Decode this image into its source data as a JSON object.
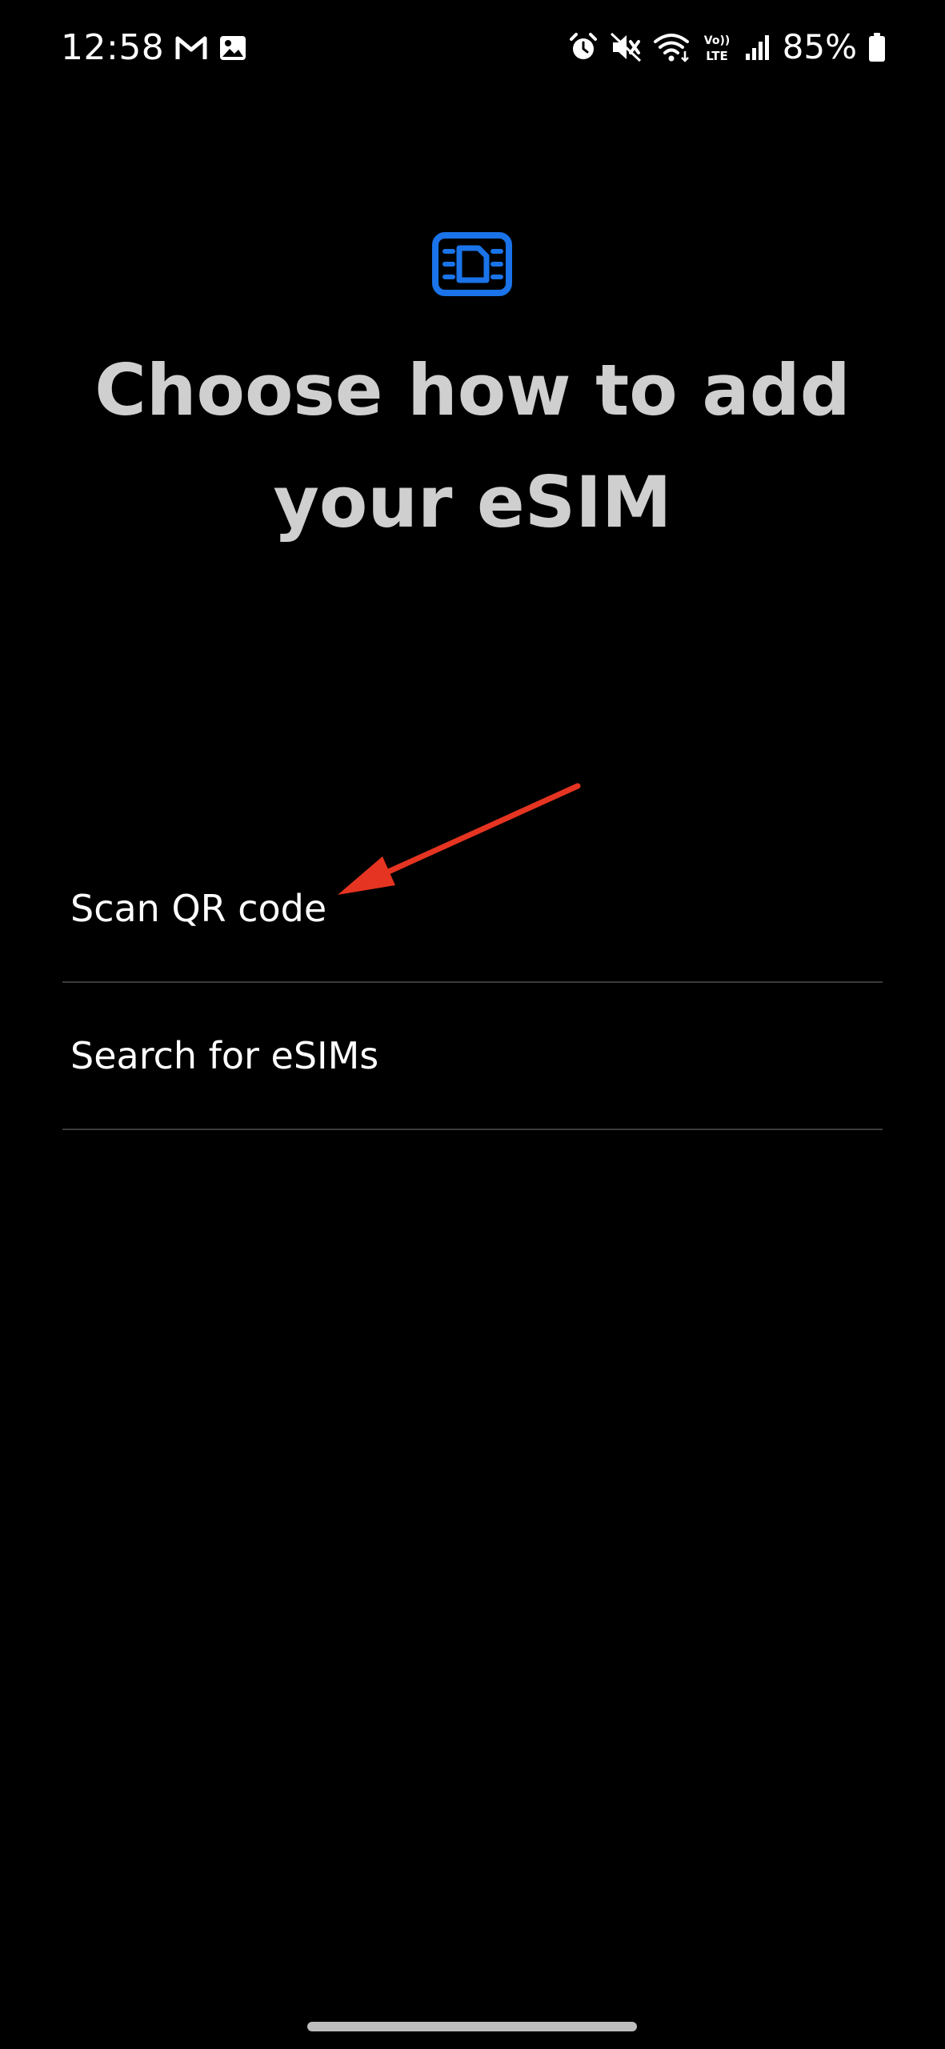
{
  "status_bar": {
    "time": "12:58",
    "battery_percent": "85%",
    "left_icons": [
      "gmail-icon",
      "gallery-icon"
    ],
    "right_icons": [
      "alarm-icon",
      "mute-icon",
      "wifi-icon",
      "volte-lte-icon",
      "signal-icon",
      "battery-icon"
    ],
    "volte_label_top": "Vo))",
    "volte_label_bottom": "LTE"
  },
  "header": {
    "icon": "esim-card-icon",
    "title_line1": "Choose how to add",
    "title_line2": "your eSIM"
  },
  "options": [
    {
      "label": "Scan QR code"
    },
    {
      "label": "Search for eSIMs"
    }
  ],
  "colors": {
    "background": "#000000",
    "accent_blue": "#1a73e8",
    "annotation_red": "#e53421",
    "title_gray": "#cfcfcf",
    "divider": "#3a3a3a"
  }
}
